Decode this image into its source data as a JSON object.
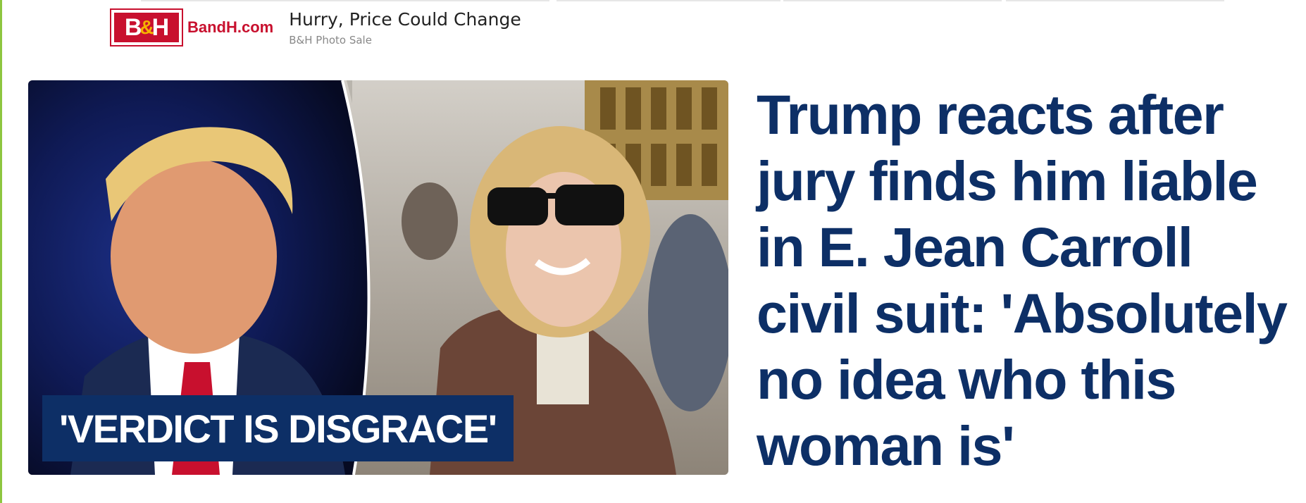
{
  "ad": {
    "logo_text": "B&H",
    "domain": "BandH.com",
    "headline": "Hurry, Price Could Change",
    "source": "B&H Photo Sale"
  },
  "story": {
    "image_caption": "'VERDICT IS DISGRACE'",
    "headline": "Trump reacts after jury finds him liable in E. Jean Carroll civil suit: 'Absolutely no idea who this woman is'"
  },
  "colors": {
    "headline_blue": "#0d2f66",
    "caption_bg": "#0d2f66",
    "brand_red": "#c8102e",
    "left_accent": "#8dc63f"
  }
}
